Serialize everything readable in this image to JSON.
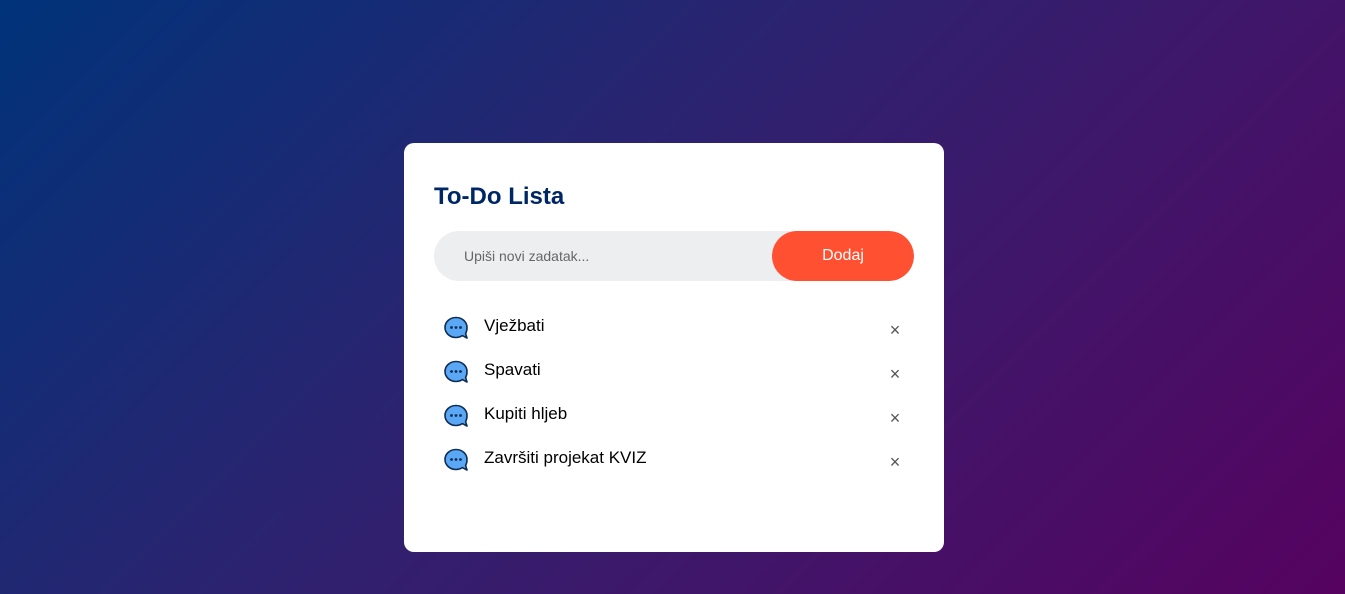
{
  "app": {
    "title": "To-Do Lista"
  },
  "input": {
    "placeholder": "Upiši novi zadatak...",
    "value": ""
  },
  "add_button": {
    "label": "Dodaj"
  },
  "tasks": [
    {
      "text": "Vježbati",
      "icon": "chat-bubble-icon",
      "remove": "×"
    },
    {
      "text": "Spavati",
      "icon": "chat-bubble-icon",
      "remove": "×"
    },
    {
      "text": "Kupiti hljeb",
      "icon": "chat-bubble-icon",
      "remove": "×"
    },
    {
      "text": "Završiti projekat KVIZ",
      "icon": "chat-bubble-icon",
      "remove": "×"
    }
  ],
  "colors": {
    "accent": "#ff5031",
    "title": "#002765",
    "input_bg": "#edeef0",
    "icon_fill": "#5aa8f5",
    "background_start": "#00337a",
    "background_end": "#560260"
  }
}
